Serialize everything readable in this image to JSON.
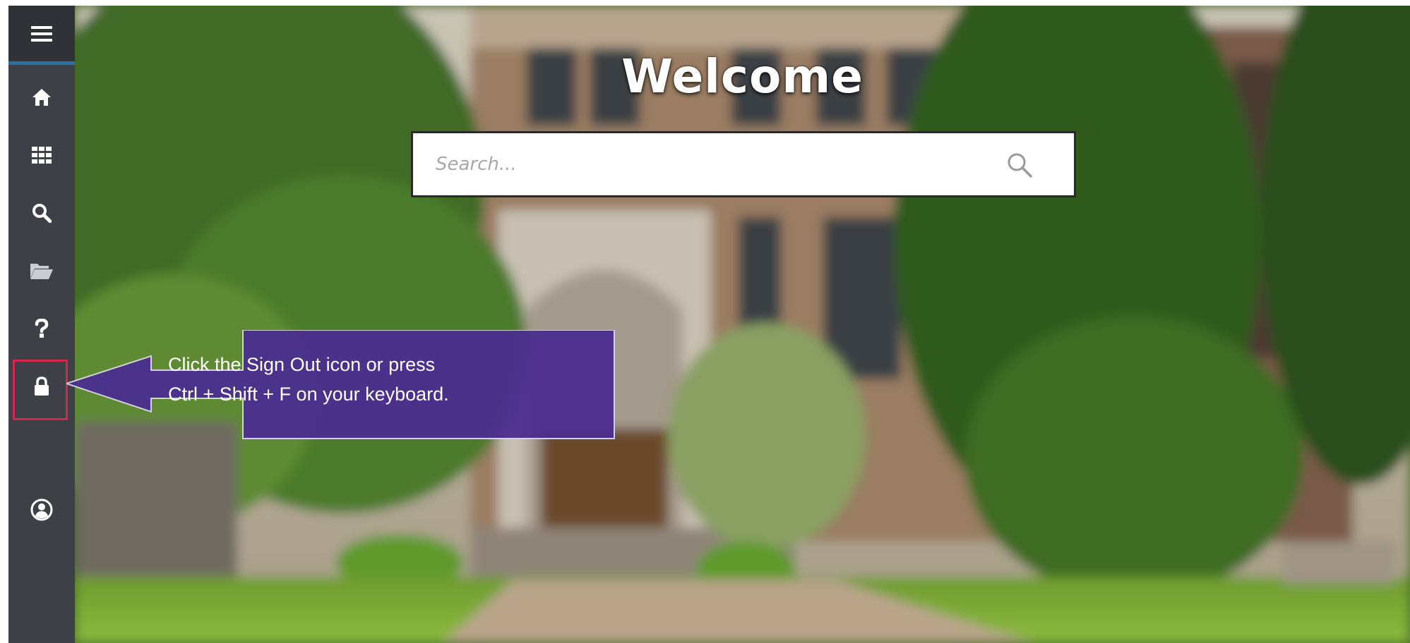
{
  "page": {
    "title": "Welcome"
  },
  "search": {
    "placeholder": "Search..."
  },
  "sidebar": {
    "items": [
      {
        "name": "menu",
        "icon": "menu-icon"
      },
      {
        "name": "home",
        "icon": "home-icon"
      },
      {
        "name": "apps",
        "icon": "grid-icon"
      },
      {
        "name": "search",
        "icon": "search-icon"
      },
      {
        "name": "files",
        "icon": "folder-open-icon"
      },
      {
        "name": "help",
        "icon": "help-icon"
      },
      {
        "name": "sign-out",
        "icon": "lock-icon",
        "highlighted": true
      },
      {
        "name": "profile",
        "icon": "user-circle-icon"
      }
    ]
  },
  "callout": {
    "line1": "Click the Sign Out icon or press",
    "line2": "Ctrl + Shift + F on your keyboard."
  },
  "colors": {
    "sidebar": "#3d4046",
    "sidebar_accent": "#2b6fa3",
    "highlight_border": "#d6264f",
    "callout_fill": "#4b2e8f"
  }
}
